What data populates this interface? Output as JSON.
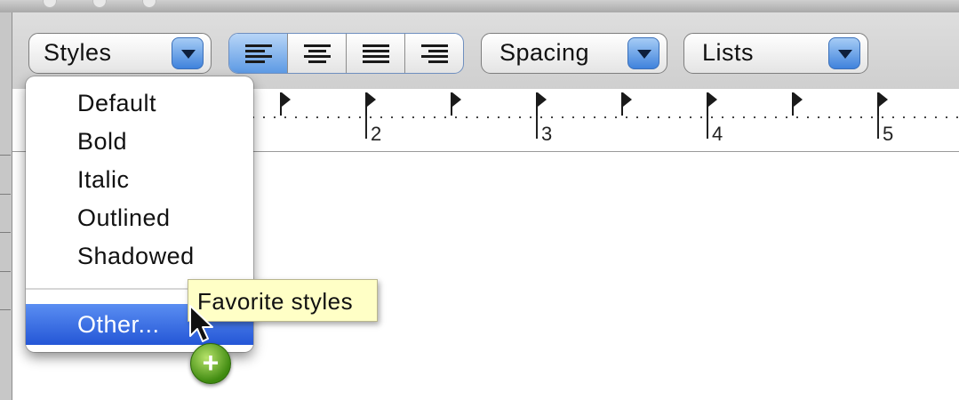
{
  "toolbar": {
    "styles_label": "Styles",
    "spacing_label": "Spacing",
    "lists_label": "Lists",
    "alignment_buttons": [
      "align-left",
      "align-center",
      "align-justify",
      "align-right"
    ],
    "selected_alignment": "align-left"
  },
  "ruler": {
    "numbers": [
      "2",
      "3",
      "4",
      "5"
    ]
  },
  "styles_menu": {
    "items": [
      "Default",
      "Bold",
      "Italic",
      "Outlined",
      "Shadowed"
    ],
    "highlighted_item": "Other..."
  },
  "tooltip": {
    "text": "Favorite styles"
  },
  "drag_badge": {
    "symbol": "+",
    "icon": "add-plus-icon"
  },
  "colors": {
    "menu_highlight": "#2456d6",
    "popup_arrow": "#3f82dc",
    "tooltip_bg": "#ffffc6",
    "add_badge": "#3f8a10"
  }
}
